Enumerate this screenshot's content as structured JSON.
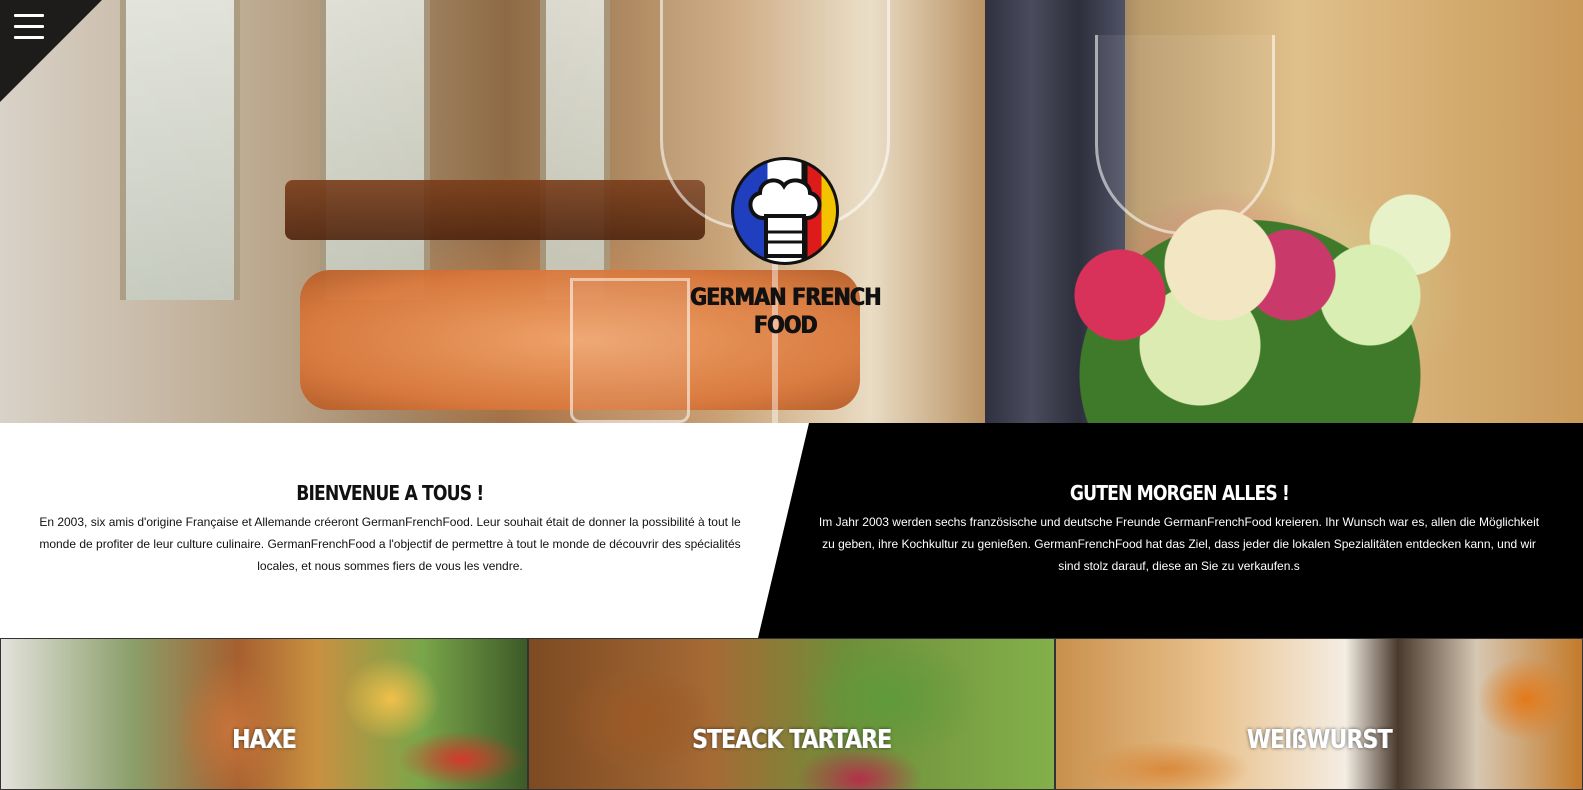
{
  "header": {
    "brand": "GERMAN FRENCH FOOD",
    "menu_icon": "hamburger-menu-icon",
    "logo_icon": "chef-hat-icon",
    "colors": {
      "france_blue": "#1f3fbf",
      "germany_red": "#dd1b1b",
      "germany_gold": "#f3c300",
      "dark": "#000000"
    }
  },
  "intro": {
    "fr": {
      "heading": "BIENVENUE A TOUS !",
      "text": "En 2003, six amis d'origine Française et Allemande créeront GermanFrenchFood. Leur souhait était de donner la possibilité à tout le monde de profiter de leur culture culinaire. GermanFrenchFood a l'objectif de permettre à tout le monde de découvrir des spécialités locales, et nous sommes fiers de vous les vendre."
    },
    "de": {
      "heading": "GUTEN MORGEN ALLES !",
      "text": "Im Jahr 2003 werden sechs französische und deutsche Freunde GermanFrenchFood kreieren. Ihr Wunsch war es, allen die Möglichkeit zu geben, ihre Kochkultur zu genießen. GermanFrenchFood hat das Ziel, dass jeder die lokalen Spezialitäten entdecken kann, und wir sind stolz darauf, diese an Sie zu verkaufen.s"
    }
  },
  "dishes": [
    {
      "label": "HAXE"
    },
    {
      "label": "STEACK TARTARE"
    },
    {
      "label": "WEIßWURST"
    }
  ]
}
